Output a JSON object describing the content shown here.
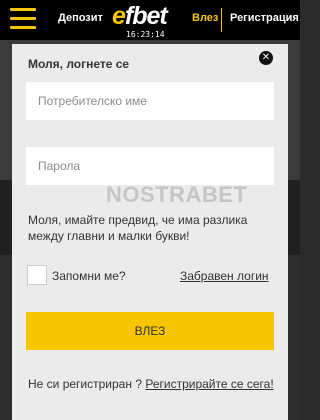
{
  "header": {
    "menu_icon": "hamburger-menu-icon",
    "deposit_label": "Депозит",
    "logo_e": "e",
    "logo_rest": "fbet",
    "time": "16:23:14",
    "login_label": "Влез",
    "register_label": "Регистрация",
    "accent_color": "#f7c600"
  },
  "modal": {
    "title": "Моля, логнете се",
    "close_icon": "close-icon",
    "username": {
      "value": "",
      "placeholder": "Потребителско име"
    },
    "password": {
      "value": "",
      "placeholder": "Парола"
    },
    "watermark": "NOSTRABET",
    "hint": "Моля, имайте предвид, че има разлика между главни и малки букви!",
    "remember_label": "Запомни ме?",
    "remember_checked": false,
    "forgot_label": "Забравен логин",
    "submit_label": "ВЛЕЗ",
    "footer_prefix": "Не си регистриран ?",
    "footer_link": "Регистрирайте се сега!",
    "button_color": "#f7c600"
  }
}
